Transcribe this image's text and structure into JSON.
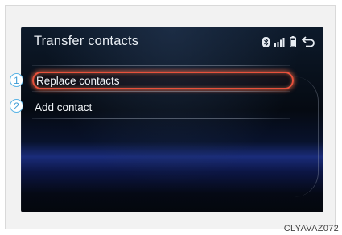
{
  "screen": {
    "title": "Transfer contacts",
    "status_icons": [
      "bluetooth-icon",
      "signal-icon",
      "battery-icon",
      "back-icon"
    ]
  },
  "menu": {
    "items": [
      {
        "label": "Replace contacts",
        "callout": "1",
        "selected": true
      },
      {
        "label": "Add contact",
        "callout": "2",
        "selected": false
      }
    ]
  },
  "figure": {
    "caption": "CLYAVAZ072"
  },
  "colors": {
    "highlight": "#e8513c",
    "callout": "#5ab4e6"
  }
}
